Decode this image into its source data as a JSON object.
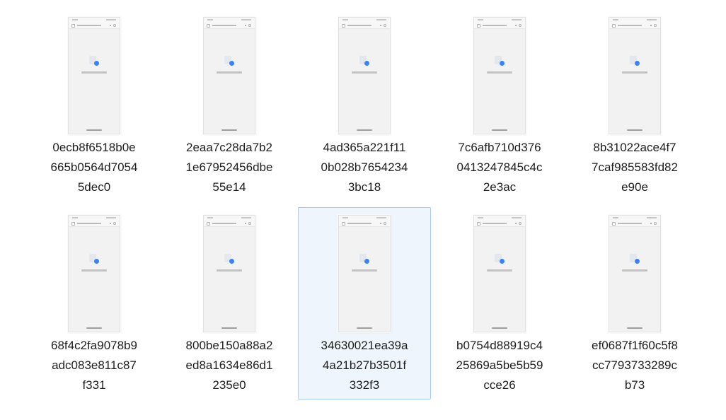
{
  "files": [
    {
      "name_lines": [
        "0ecb8f6518b0e",
        "665b0564d7054",
        "5dec0"
      ],
      "selected": false
    },
    {
      "name_lines": [
        "2eaa7c28da7b2",
        "1e67952456dbe",
        "55e14"
      ],
      "selected": false
    },
    {
      "name_lines": [
        "4ad365a221f11",
        "0b028b7654234",
        "3bc18"
      ],
      "selected": false
    },
    {
      "name_lines": [
        "7c6afb710d376",
        "0413247845c4c",
        "2e3ac"
      ],
      "selected": false
    },
    {
      "name_lines": [
        "8b31022ace4f7",
        "7caf985583fd82",
        "e90e"
      ],
      "selected": false
    },
    {
      "name_lines": [
        "68f4c2fa9078b9",
        "adc083e811c87",
        "f331"
      ],
      "selected": false
    },
    {
      "name_lines": [
        "800be150a88a2",
        "ed8a1634e86d1",
        "235e0"
      ],
      "selected": false
    },
    {
      "name_lines": [
        "34630021ea39a",
        "4a21b27b3501f",
        "332f3"
      ],
      "selected": true
    },
    {
      "name_lines": [
        "b0754d88919c4",
        "25869a5be5b59",
        "cce26"
      ],
      "selected": false
    },
    {
      "name_lines": [
        "ef0687f1f60c5f8",
        "cc7793733289c",
        "b73"
      ],
      "selected": false
    }
  ],
  "colors": {
    "selection_bg": "#eef5fd",
    "selection_border": "#a9cdf2",
    "loader_accent": "#3b82f6"
  },
  "icons": {
    "thumbnail": "phone-screenshot-thumbnail",
    "loader": "loading-doc-icon"
  }
}
